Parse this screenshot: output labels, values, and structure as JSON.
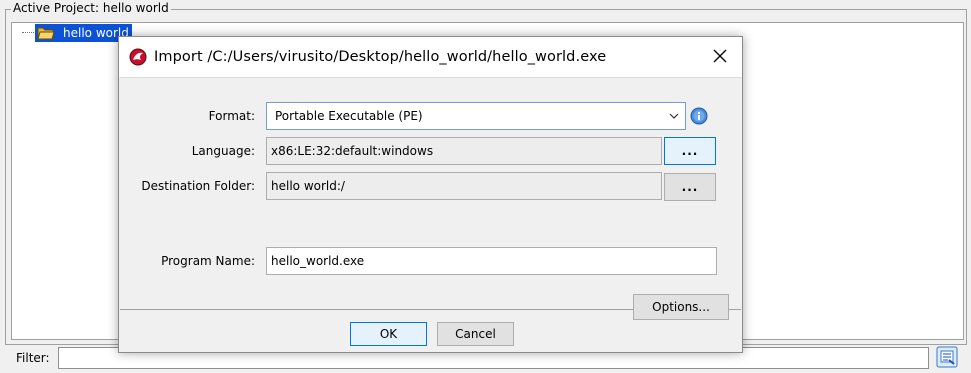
{
  "project": {
    "legend": "Active Project: hello world",
    "tree_root_label": "hello world",
    "filter_label": "Filter:",
    "filter_value": "",
    "icons": {
      "folder": "folder-open-icon",
      "filter": "filter-clear-icon"
    }
  },
  "dialog": {
    "title": "Import /C:/Users/virusito/Desktop/hello_world/hello_world.exe",
    "icons": {
      "app": "ghidra-dragon-icon",
      "close": "close-icon",
      "info": "info-icon",
      "dropdown": "chevron-down-icon"
    },
    "format": {
      "label": "Format:",
      "value": "Portable Executable (PE)"
    },
    "language": {
      "label": "Language:",
      "value": "x86:LE:32:default:windows",
      "button_label": "..."
    },
    "destination": {
      "label": "Destination Folder:",
      "value": "hello world:/",
      "button_label": "..."
    },
    "program_name": {
      "label": "Program Name:",
      "value": "hello_world.exe"
    },
    "options_button": "Options...",
    "ok_button": "OK",
    "cancel_button": "Cancel"
  }
}
